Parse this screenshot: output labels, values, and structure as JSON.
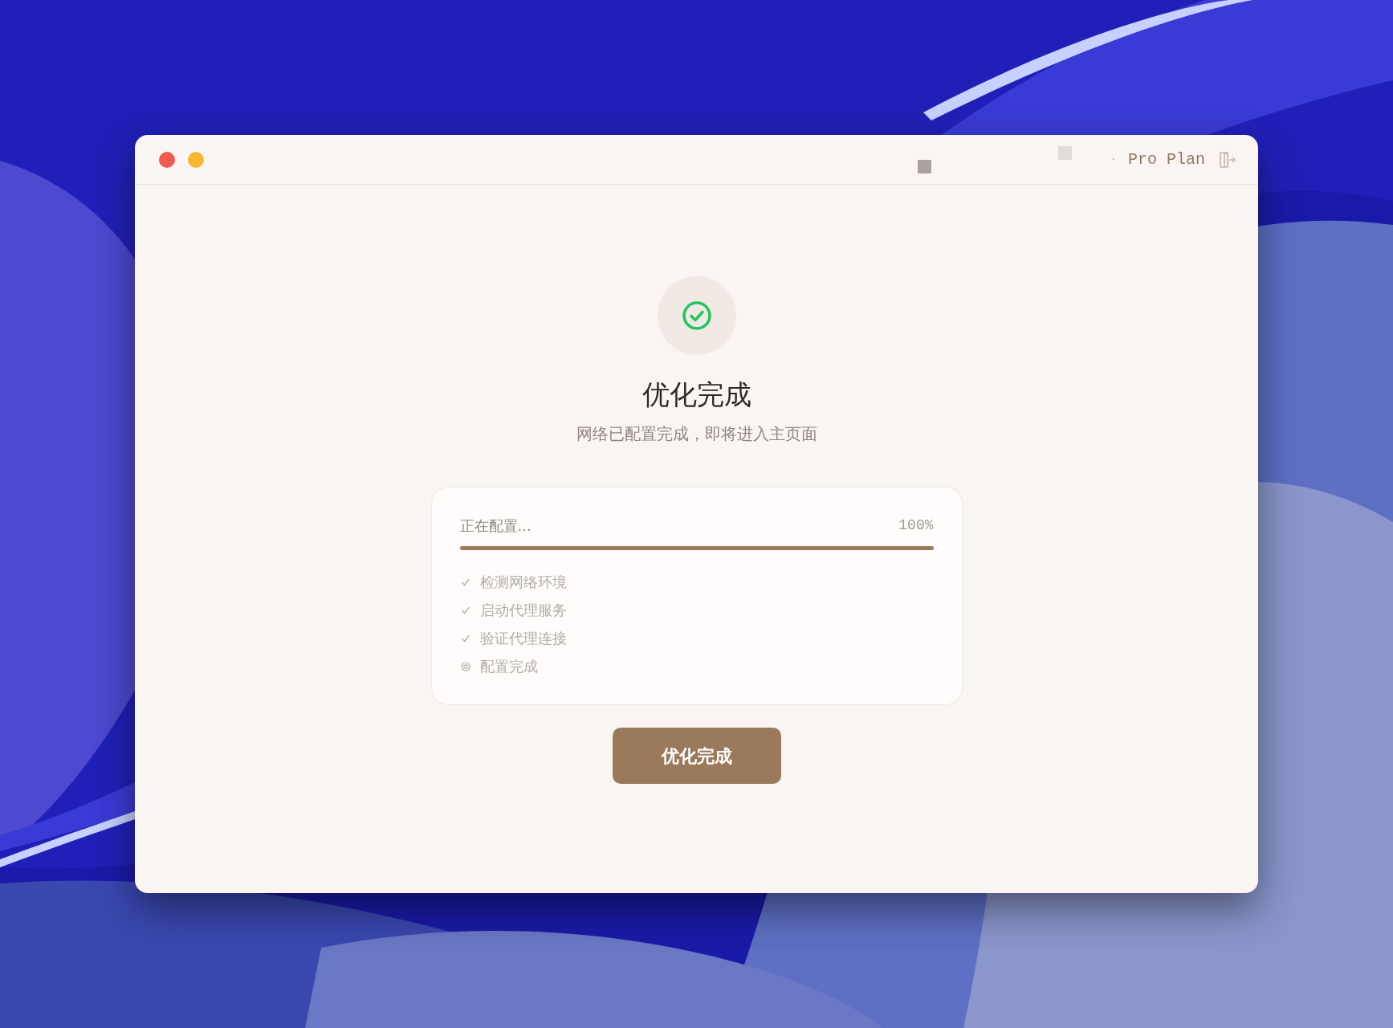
{
  "window": {
    "traffic_lights": [
      {
        "color": "#f05a4f"
      },
      {
        "color": "#f5b72d"
      }
    ],
    "separator": "·",
    "plan": "Pro Plan"
  },
  "status": {
    "done": true,
    "title": "优化完成",
    "subtitle": "网络已配置完成，即将进入主页面"
  },
  "progress": {
    "label": "正在配置...",
    "reading": "100%",
    "level": 1.0,
    "steps": [
      {
        "text": "检测网络环境",
        "done": true
      },
      {
        "text": "启动代理服务",
        "done": true
      },
      {
        "text": "验证代理连接",
        "done": true
      },
      {
        "text": "配置完成",
        "done": false
      }
    ]
  },
  "button": "优化完成"
}
